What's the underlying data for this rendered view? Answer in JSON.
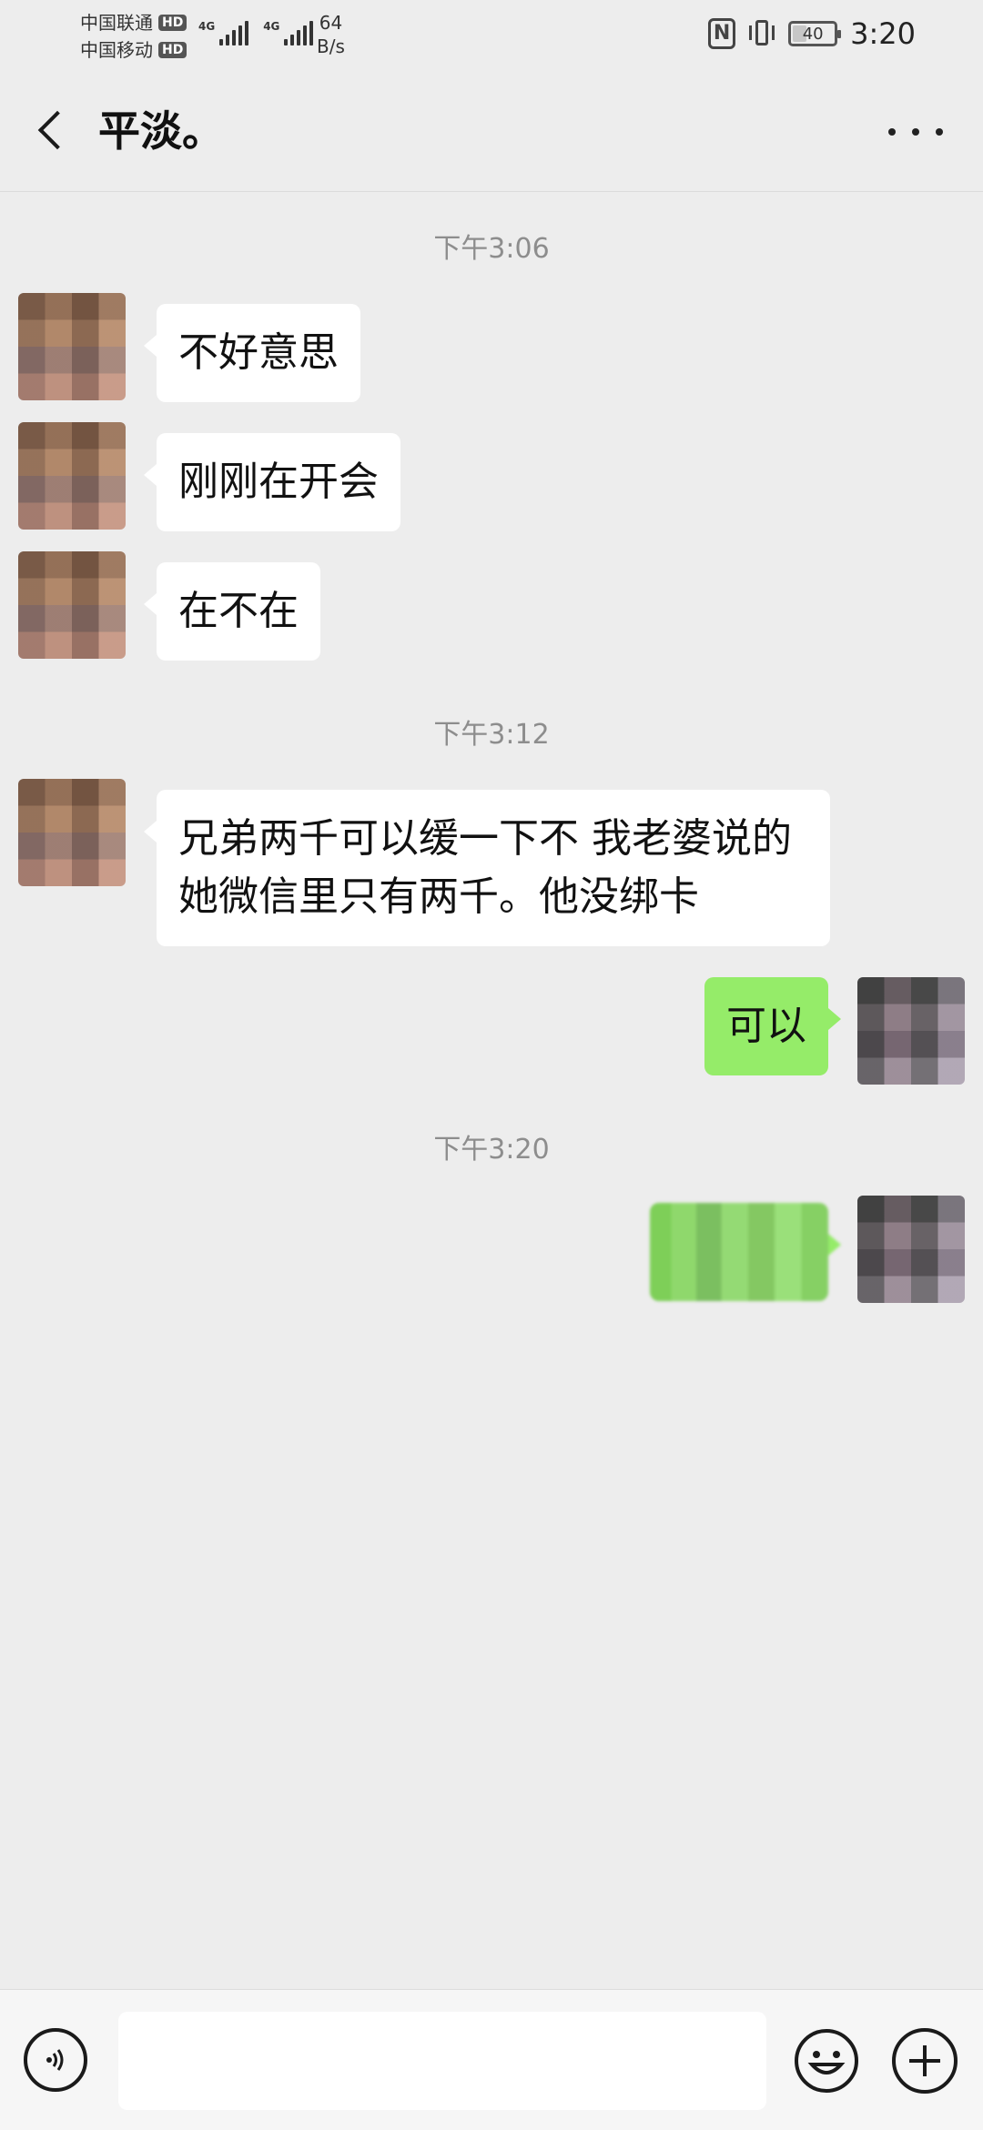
{
  "status_bar": {
    "carrier1": "中国联通",
    "carrier2": "中国移动",
    "hd_label": "HD",
    "network1": "4G",
    "network2": "4G",
    "speed_value": "64",
    "speed_unit": "B/s",
    "battery_level": "40",
    "time": "3:20",
    "icons": [
      "nfc-icon",
      "vibrate-icon",
      "battery-icon"
    ]
  },
  "header": {
    "title": "平淡。",
    "back_icon": "chevron-left-icon",
    "more_icon": "more-dots-icon"
  },
  "chat": {
    "timestamps": [
      "下午3:06",
      "下午3:12",
      "下午3:20"
    ],
    "messages": [
      {
        "side": "in",
        "text": "不好意思"
      },
      {
        "side": "in",
        "text": "刚刚在开会"
      },
      {
        "side": "in",
        "text": "在不在"
      },
      {
        "side": "in",
        "text": "兄弟两千可以缓一下不  我老婆说的她微信里只有两千。他没绑卡"
      },
      {
        "side": "out",
        "text": "可以"
      },
      {
        "side": "out",
        "text": ""
      }
    ]
  },
  "input_bar": {
    "voice_icon": "voice-icon",
    "emoji_icon": "emoji-icon",
    "plus_icon": "plus-icon",
    "placeholder": ""
  },
  "colors": {
    "background": "#ededed",
    "incoming_bubble": "#ffffff",
    "outgoing_bubble": "#95ec69",
    "timestamp": "#8d8d8d"
  }
}
